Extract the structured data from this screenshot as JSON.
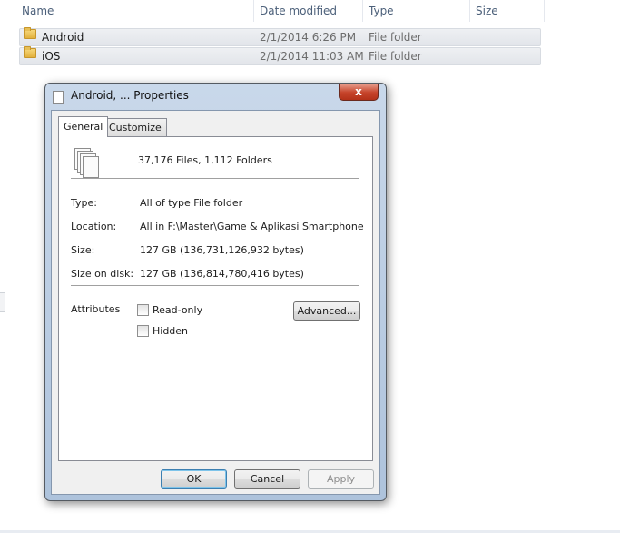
{
  "explorer": {
    "columns": [
      "Name",
      "Date modified",
      "Type",
      "Size"
    ],
    "rows": [
      {
        "name": "Android",
        "date": "2/1/2014 6:26 PM",
        "type": "File folder"
      },
      {
        "name": "iOS",
        "date": "2/1/2014 11:03 AM",
        "type": "File folder"
      }
    ]
  },
  "dialog": {
    "title": "Android, ... Properties",
    "close_label": "x",
    "tabs": [
      {
        "label": "General",
        "active": true
      },
      {
        "label": "Customize",
        "active": false
      }
    ],
    "summary": "37,176 Files, 1,112 Folders",
    "details": [
      {
        "label": "Type:",
        "value": "All of type File folder"
      },
      {
        "label": "Location:",
        "value": "All in F:\\Master\\Game & Aplikasi Smartphone"
      },
      {
        "label": "Size:",
        "value": "127 GB (136,731,126,932 bytes)"
      },
      {
        "label": "Size on disk:",
        "value": "127 GB (136,814,780,416 bytes)"
      }
    ],
    "attributes_label": "Attributes",
    "read_only_label": "Read-only",
    "read_only_checked": false,
    "hidden_label": "Hidden",
    "hidden_checked": false,
    "advanced_label": "Advanced...",
    "ok_label": "OK",
    "cancel_label": "Cancel",
    "apply_label": "Apply",
    "apply_enabled": false
  },
  "icons": [
    "sort-arrow-icon",
    "folder-icon",
    "properties-icon",
    "close-icon",
    "multiple-files-icon",
    "checkbox"
  ],
  "colors": {
    "title_bar": "#b9cde4",
    "close_button": "#c6442b",
    "default_button_border": "#3c7fb1"
  }
}
